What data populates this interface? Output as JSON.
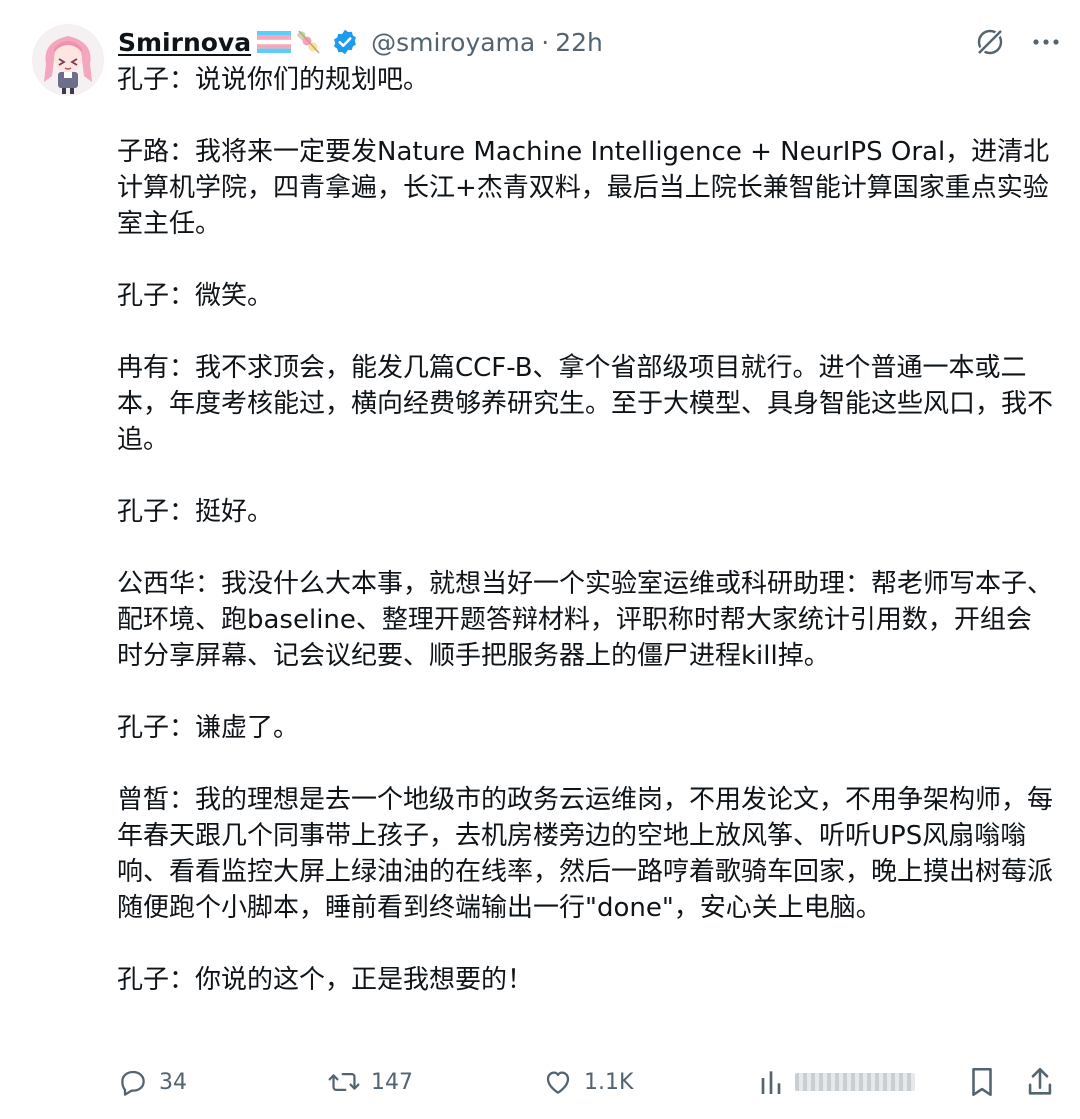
{
  "user": {
    "display_name": "Smirnova",
    "handle": "@smiroyama",
    "separator": "·",
    "time": "22h",
    "verified": true,
    "flag_icon": "transgender-flag-icon",
    "sparkle_icon": "sparkles-icon"
  },
  "tweet": {
    "paragraphs": [
      "孔子：说说你们的规划吧。",
      "子路：我将来一定要发Nature Machine Intelligence + NeurIPS Oral，进清北计算机学院，四青拿遍，长江+杰青双料，最后当上院长兼智能计算国家重点实验室主任。",
      "孔子：微笑。",
      "冉有：我不求顶会，能发几篇CCF-B、拿个省部级项目就行。进个普通一本或二本，年度考核能过，横向经费够养研究生。至于大模型、具身智能这些风口，我不追。",
      "孔子：挺好。",
      "公西华：我没什么大本事，就想当好一个实验室运维或科研助理：帮老师写本子、配环境、跑baseline、整理开题答辩材料，评职称时帮大家统计引用数，开组会时分享屏幕、记会议纪要、顺手把服务器上的僵尸进程kill掉。",
      "孔子：谦虚了。",
      "曾皙：我的理想是去一个地级市的政务云运维岗，不用发论文，不用争架构师，每年春天跟几个同事带上孩子，去机房楼旁边的空地上放风筝、听听UPS风扇嗡嗡响、看看监控大屏上绿油油的在线率，然后一路哼着歌骑车回家，晚上摸出树莓派随便跑个小脚本，睡前看到终端输出一行\"done\"，安心关上电脑。",
      "孔子：你说的这个，正是我想要的！"
    ]
  },
  "actions": {
    "replies": "34",
    "reposts": "147",
    "likes": "1.1K"
  },
  "colors": {
    "text": "#0f1419",
    "secondary": "#536471",
    "verified_blue": "#1d9bf0",
    "background": "#ffffff"
  }
}
